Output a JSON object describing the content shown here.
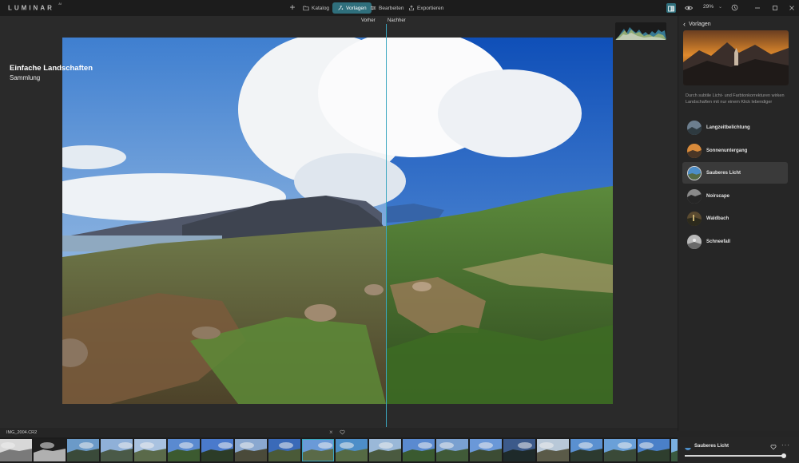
{
  "app": {
    "logo": "LUMINAR",
    "logo_sup": "AI"
  },
  "topbar": {
    "nav": [
      {
        "label": "Katalog",
        "icon": "folder-icon",
        "active": false
      },
      {
        "label": "Vorlagen",
        "icon": "sparkle-icon",
        "active": true
      },
      {
        "label": "Bearbeiten",
        "icon": "sliders-icon",
        "active": false
      },
      {
        "label": "Exportieren",
        "icon": "share-icon",
        "active": false
      }
    ],
    "zoom": "29%",
    "accent": "#2f6f7c"
  },
  "canvas": {
    "before_label": "Vorher",
    "after_label": "Nachher",
    "split_line_color": "#3ba7c0"
  },
  "panel": {
    "back_label": "Vorlagen",
    "collection_title": "Einfache Landschaften",
    "collection_sub": "Sammlung",
    "description": "Durch subtile Licht- und Farbtonkorrekturen wirken Landschaften mit nur einem Klick lebendiger",
    "presets": [
      {
        "name": "Langzeitbelichtung",
        "selected": false
      },
      {
        "name": "Sonnenuntergang",
        "selected": false
      },
      {
        "name": "Sauberes Licht",
        "selected": true
      },
      {
        "name": "Noirscape",
        "selected": false
      },
      {
        "name": "Waldbach",
        "selected": false
      },
      {
        "name": "Schneefall",
        "selected": false
      }
    ]
  },
  "filmstrip": {
    "file_name": "IMG_2004.CR2",
    "current_index": 9
  },
  "bottom": {
    "preset_name": "Sauberes Licht",
    "amount": 1.0
  }
}
